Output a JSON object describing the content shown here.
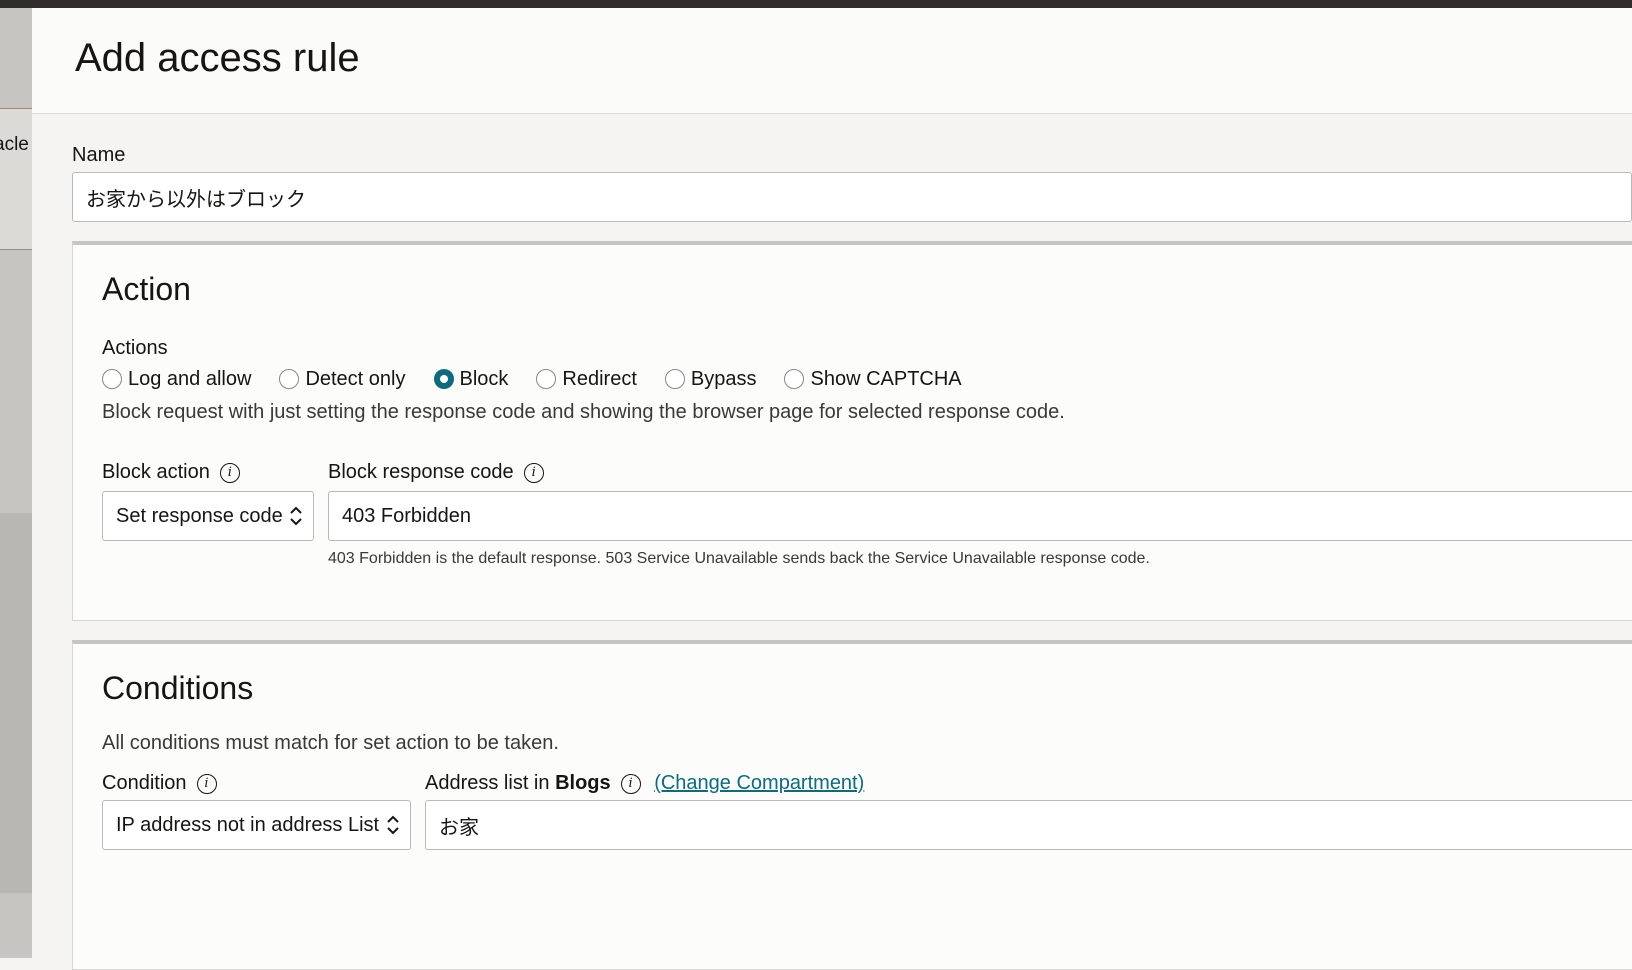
{
  "panel": {
    "title": "Add access rule",
    "left_strip_text": "acle"
  },
  "name_field": {
    "label": "Name",
    "value": "お家から以外はブロック"
  },
  "action_section": {
    "title": "Action",
    "actions_label": "Actions",
    "options": [
      {
        "label": "Log and allow",
        "checked": false
      },
      {
        "label": "Detect only",
        "checked": false
      },
      {
        "label": "Block",
        "checked": true
      },
      {
        "label": "Redirect",
        "checked": false
      },
      {
        "label": "Bypass",
        "checked": false
      },
      {
        "label": "Show CAPTCHA",
        "checked": false
      }
    ],
    "description": "Block request with just setting the response code and showing the browser page for selected response code.",
    "block_action_label": "Block action",
    "block_action_value": "Set response code",
    "response_code_label": "Block response code",
    "response_code_value": "403 Forbidden",
    "response_code_help": "403 Forbidden is the default response. 503 Service Unavailable sends back the Service Unavailable response code."
  },
  "conditions_section": {
    "title": "Conditions",
    "description": "All conditions must match for set action to be taken.",
    "condition_label": "Condition",
    "condition_value": "IP address not in address List",
    "address_list_label_prefix": "Address list in",
    "address_list_compartment": "Blogs",
    "change_compartment_link": "(Change Compartment)",
    "address_list_value": "お家"
  },
  "colors": {
    "accent": "#0e6b7d",
    "topbar": "#312d2a"
  },
  "icons": [
    "info-icon",
    "chevron-updown-icon",
    "radio-icon"
  ]
}
